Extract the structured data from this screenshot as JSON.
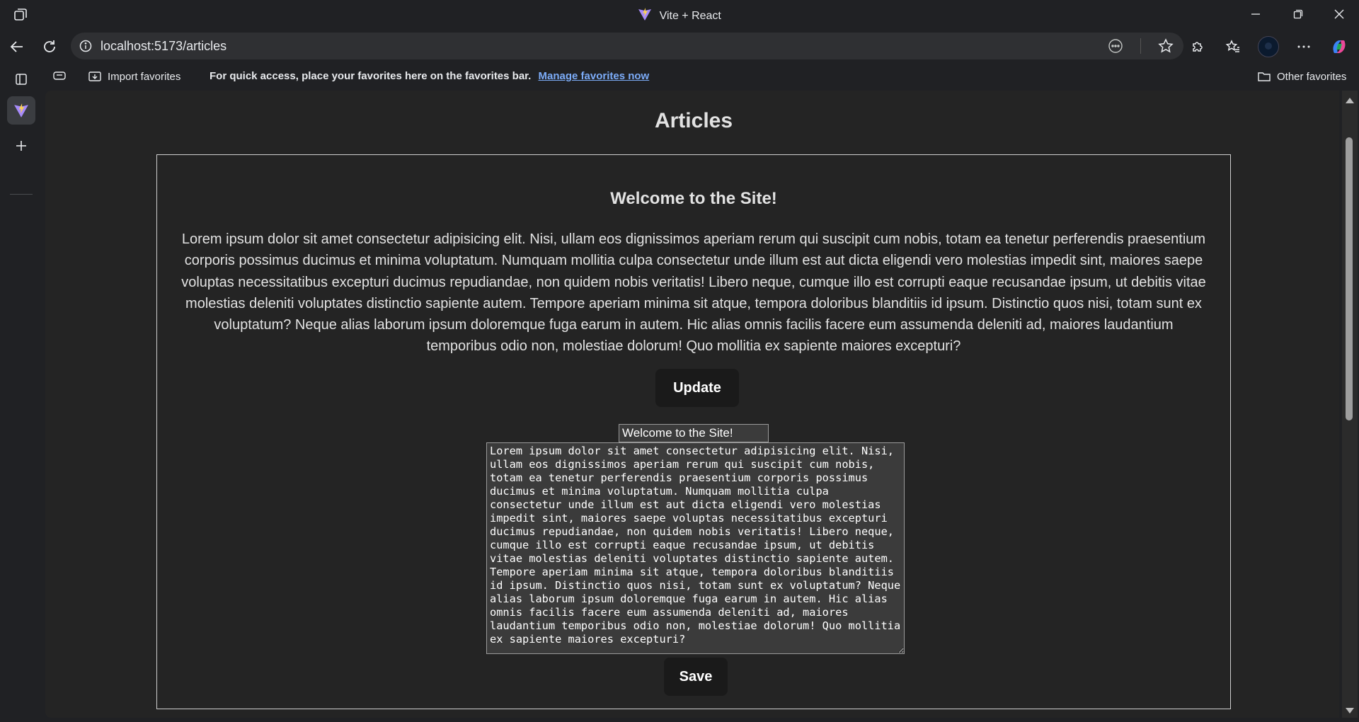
{
  "window": {
    "title": "Vite + React"
  },
  "address_bar": {
    "url": "localhost:5173/articles"
  },
  "favorites_bar": {
    "import_label": "Import favorites",
    "message": "For quick access, place your favorites here on the favorites bar.",
    "manage_link": "Manage favorites now",
    "other_label": "Other favorites"
  },
  "page": {
    "heading": "Articles",
    "article": {
      "title": "Welcome to the Site!",
      "body": "Lorem ipsum dolor sit amet consectetur adipisicing elit. Nisi, ullam eos dignissimos aperiam rerum qui suscipit cum nobis, totam ea tenetur perferendis praesentium corporis possimus ducimus et minima voluptatum. Numquam mollitia culpa consectetur unde illum est aut dicta eligendi vero molestias impedit sint, maiores saepe voluptas necessitatibus excepturi ducimus repudiandae, non quidem nobis veritatis! Libero neque, cumque illo est corrupti eaque recusandae ipsum, ut debitis vitae molestias deleniti voluptates distinctio sapiente autem. Tempore aperiam minima sit atque, tempora doloribus blanditiis id ipsum. Distinctio quos nisi, totam sunt ex voluptatum? Neque alias laborum ipsum doloremque fuga earum in autem. Hic alias omnis facilis facere eum assumenda deleniti ad, maiores laudantium temporibus odio non, molestiae dolorum! Quo mollitia ex sapiente maiores excepturi?",
      "update_label": "Update",
      "edit_title_value": "Welcome to the Site!",
      "edit_body_value": "Lorem ipsum dolor sit amet consectetur adipisicing elit. Nisi, ullam eos dignissimos aperiam rerum qui suscipit cum nobis, totam ea tenetur perferendis praesentium corporis possimus ducimus et minima voluptatum. Numquam mollitia culpa consectetur unde illum est aut dicta eligendi vero molestias impedit sint, maiores saepe voluptas necessitatibus excepturi ducimus repudiandae, non quidem nobis veritatis! Libero neque, cumque illo est corrupti eaque recusandae ipsum, ut debitis vitae molestias deleniti voluptates distinctio sapiente autem. Tempore aperiam minima sit atque, tempora doloribus blanditiis id ipsum. Distinctio quos nisi, totam sunt ex voluptatum? Neque alias laborum ipsum doloremque fuga earum in autem. Hic alias omnis facilis facere eum assumenda deleniti ad, maiores laudantium temporibus odio non, molestiae dolorum! Quo mollitia ex sapiente maiores excepturi?",
      "save_label": "Save"
    }
  },
  "icons": {
    "tab_actions": "tab-actions-icon",
    "vite_logo": "vite-logo-icon",
    "minimize": "minimize-icon",
    "restore": "restore-icon",
    "close": "close-icon",
    "back": "back-arrow-icon",
    "refresh": "refresh-icon",
    "site_info": "info-icon",
    "read_aloud": "more-circle-icon",
    "favorite": "star-icon",
    "extensions": "puzzle-icon",
    "favorites": "favorites-icon",
    "profile": "avatar",
    "menu": "more-icon",
    "copilot": "copilot-icon",
    "vertical_tabs": "vertical-tabs-icon",
    "add_tab": "plus-icon"
  },
  "colors": {
    "browser_bg": "#202124",
    "page_bg": "#242424",
    "button_bg": "#1a1a1a",
    "link": "#7cacf8"
  }
}
